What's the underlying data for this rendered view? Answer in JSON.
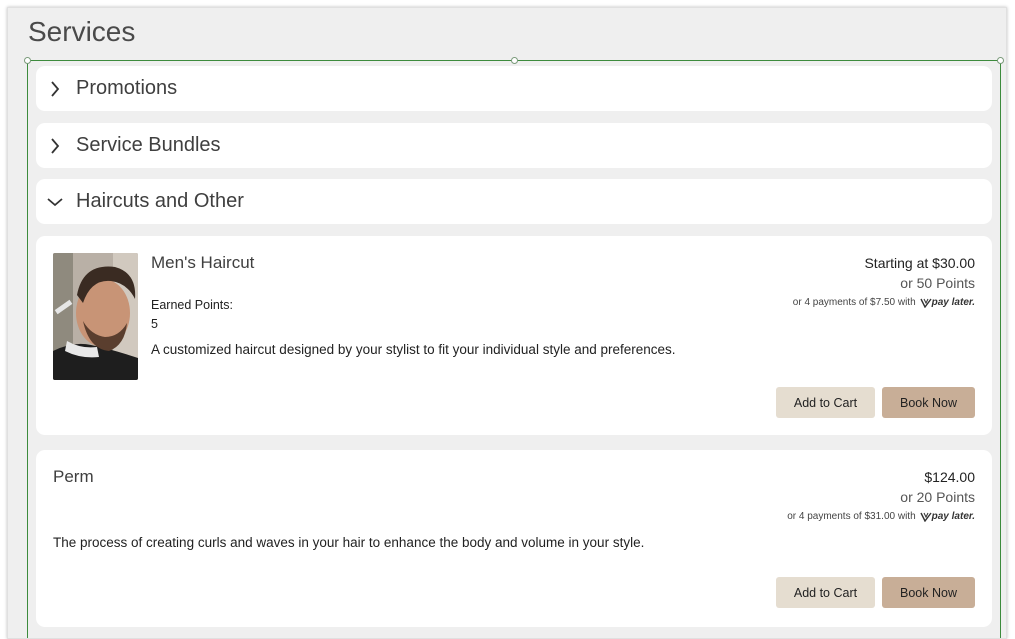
{
  "page": {
    "title": "Services"
  },
  "categories": [
    {
      "label": "Promotions",
      "expanded": false,
      "icon": "chevron-right-icon"
    },
    {
      "label": "Service Bundles",
      "expanded": false,
      "icon": "chevron-right-icon"
    },
    {
      "label": "Haircuts and Other",
      "expanded": true,
      "icon": "chevron-down-icon"
    }
  ],
  "services": [
    {
      "name": "Men's Haircut",
      "has_image": true,
      "earned_points_label": "Earned Points:",
      "earned_points_value": "5",
      "description": "A customized haircut designed by your stylist to fit your individual style and preferences.",
      "price": "Starting at $30.00",
      "points": "or 50 Points",
      "installments": "or 4 payments of $7.50 with",
      "paylater_logo": "pay later.",
      "add_to_cart_label": "Add to Cart",
      "book_now_label": "Book Now"
    },
    {
      "name": "Perm",
      "has_image": false,
      "description": "The process of creating curls and waves in your hair to enhance the body and volume in your style.",
      "price": "$124.00",
      "points": "or 20 Points",
      "installments": "or 4 payments of $31.00 with",
      "paylater_logo": "pay later.",
      "add_to_cart_label": "Add to Cart",
      "book_now_label": "Book Now"
    }
  ],
  "colors": {
    "frame_border": "#3d8b3d",
    "add_to_cart_bg": "#e5ddd0",
    "book_now_bg": "#c8ae97"
  }
}
